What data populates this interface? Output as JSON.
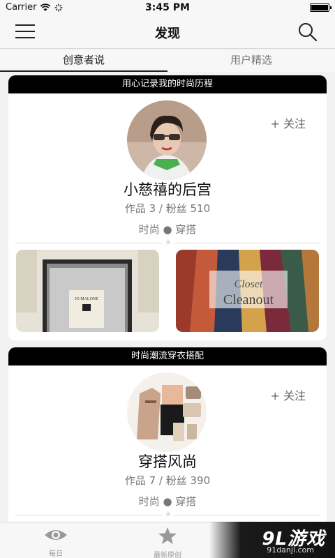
{
  "status_bar": {
    "carrier": "Carrier",
    "time": "3:45 PM"
  },
  "nav": {
    "title": "发现"
  },
  "tabs": [
    {
      "label": "创意者说",
      "active": true
    },
    {
      "label": "用户精选",
      "active": false
    }
  ],
  "cards": [
    {
      "header": "用心记录我的时尚历程",
      "follow": "+ 关注",
      "name": "小慈禧的后宫",
      "stats": "作品  3   / 粉丝  510",
      "tags": "时尚 ● 穿搭",
      "thumb_2_text_1": "Closet",
      "thumb_2_text_2": "Cleanout",
      "thumb_1_label": "JO MALONE"
    },
    {
      "header": "时尚潮流穿衣搭配",
      "follow": "+ 关注",
      "name": "穿搭风尚",
      "stats": "作品  7   / 粉丝  390",
      "tags": "时尚 ● 穿搭"
    }
  ],
  "tab_bar": [
    {
      "label": "每日",
      "icon": "eye-icon"
    },
    {
      "label": "最新原创",
      "icon": "star-icon"
    }
  ],
  "watermark": {
    "main": "9L游戏",
    "sub": "91danji.com"
  }
}
